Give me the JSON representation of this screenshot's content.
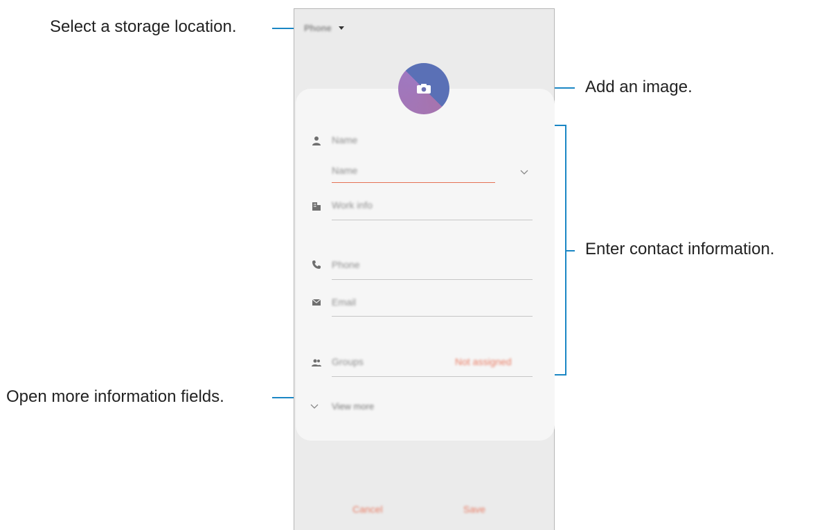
{
  "callouts": {
    "storage": "Select a storage location.",
    "image": "Add an image.",
    "contact": "Enter contact information.",
    "more": "Open more information fields."
  },
  "screen": {
    "storage_label": "Phone",
    "fields": {
      "name_header": "Name",
      "name_input": "Name",
      "work_info": "Work info",
      "phone": "Phone",
      "email": "Email",
      "groups": "Groups",
      "groups_value": "Not assigned",
      "view_more": "View more"
    },
    "buttons": {
      "cancel": "Cancel",
      "save": "Save"
    }
  },
  "colors": {
    "callout_line": "#1a86c4",
    "accent": "#e87b63",
    "avatar_blue": "#5a70b6",
    "avatar_purple": "#a674ae"
  }
}
